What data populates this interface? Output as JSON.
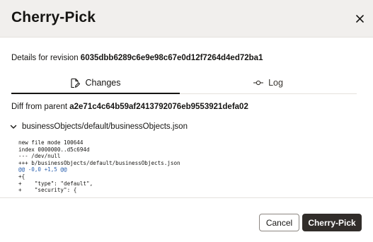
{
  "dialog": {
    "title": "Cherry-Pick",
    "close_label": "Close"
  },
  "details": {
    "prefix": "Details for revision ",
    "revision": "6035dbb6289c6e9e98c67e0d12f7264d4ed72ba1"
  },
  "tabs": [
    {
      "label": "Changes",
      "icon": "document-edit-icon",
      "selected": true
    },
    {
      "label": "Log",
      "icon": "commit-icon",
      "selected": false
    }
  ],
  "diff": {
    "prefix": "Diff from parent ",
    "parent": "a2e71c4c64b59af2413792076eb9553921defa02",
    "file": "businessObjects/default/businessObjects.json",
    "lines": [
      "new file mode 100644",
      "index 0000000..d5c694d",
      "--- /dev/null",
      "+++ b/businessObjects/default/businessObjects.json",
      "@@ -0,0 +1,5 @@",
      "+{",
      "+    \"type\": \"default\",",
      "+    \"security\": {"
    ]
  },
  "footer": {
    "cancel_label": "Cancel",
    "confirm_label": "Cherry-Pick"
  },
  "colors": {
    "header_bg": "#f1efed",
    "primary_button_bg": "#312d2a",
    "hunk_header": "#2d62b0"
  }
}
